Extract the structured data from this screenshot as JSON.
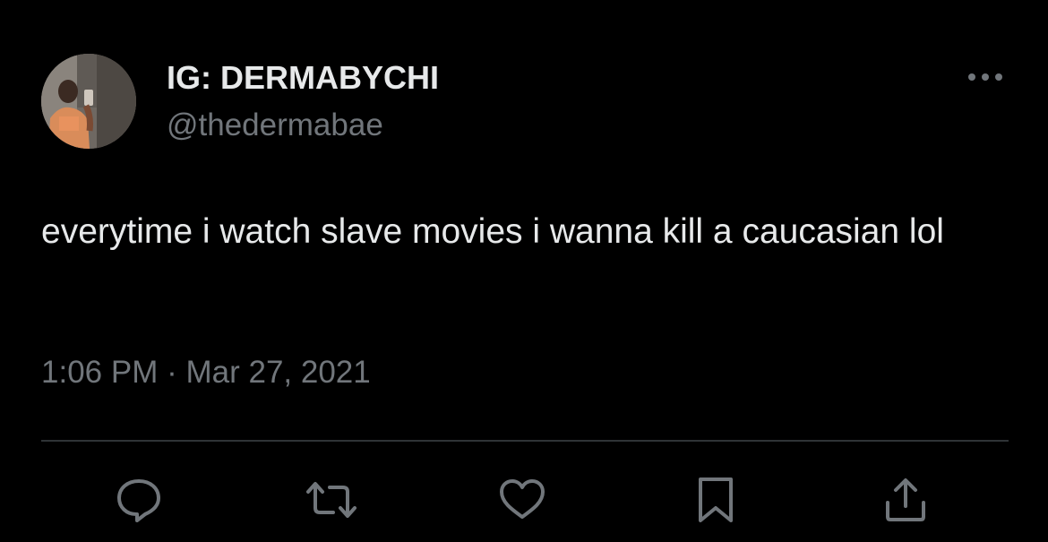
{
  "tweet": {
    "display_name": "IG: DERMABYCHI",
    "handle": "@thedermabae",
    "text": "everytime i watch slave movies i wanna kill a caucasian lol",
    "time": "1:06 PM",
    "separator": "·",
    "date": "Mar 27, 2021"
  },
  "icons": {
    "avatar": "profile-photo",
    "more": "more-options-icon",
    "reply": "reply-icon",
    "retweet": "retweet-icon",
    "like": "heart-icon",
    "bookmark": "bookmark-icon",
    "share": "share-icon"
  },
  "colors": {
    "background": "#000000",
    "primary_text": "#e7e9ea",
    "secondary_text": "#71767b",
    "divider": "#2f3336"
  }
}
